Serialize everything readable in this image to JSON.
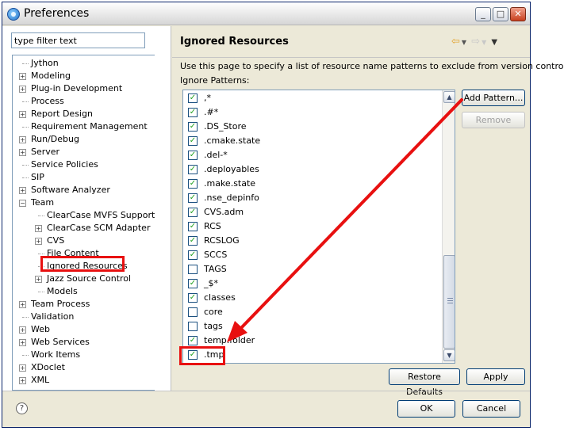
{
  "window": {
    "title": "Preferences"
  },
  "title_buttons": {
    "minimize": "_",
    "maximize": "□",
    "close": "✕"
  },
  "filter": {
    "placeholder": "type filter text"
  },
  "tree": {
    "items": [
      {
        "label": "Jython",
        "depth": 0,
        "expandable": false
      },
      {
        "label": "Modeling",
        "depth": 0,
        "expandable": true
      },
      {
        "label": "Plug-in Development",
        "depth": 0,
        "expandable": true
      },
      {
        "label": "Process",
        "depth": 0,
        "expandable": false
      },
      {
        "label": "Report Design",
        "depth": 0,
        "expandable": true
      },
      {
        "label": "Requirement Management",
        "depth": 0,
        "expandable": false
      },
      {
        "label": "Run/Debug",
        "depth": 0,
        "expandable": true
      },
      {
        "label": "Server",
        "depth": 0,
        "expandable": true
      },
      {
        "label": "Service Policies",
        "depth": 0,
        "expandable": false
      },
      {
        "label": "SIP",
        "depth": 0,
        "expandable": false
      },
      {
        "label": "Software Analyzer",
        "depth": 0,
        "expandable": true
      },
      {
        "label": "Team",
        "depth": 0,
        "expandable": true,
        "expanded": true
      },
      {
        "label": "ClearCase MVFS Support",
        "depth": 1,
        "expandable": false
      },
      {
        "label": "ClearCase SCM Adapter",
        "depth": 1,
        "expandable": true
      },
      {
        "label": "CVS",
        "depth": 1,
        "expandable": true
      },
      {
        "label": "File Content",
        "depth": 1,
        "expandable": false
      },
      {
        "label": "Ignored Resources",
        "depth": 1,
        "expandable": false,
        "selected": true
      },
      {
        "label": "Jazz Source Control",
        "depth": 1,
        "expandable": true
      },
      {
        "label": "Models",
        "depth": 1,
        "expandable": false
      },
      {
        "label": "Team Process",
        "depth": 0,
        "expandable": true
      },
      {
        "label": "Validation",
        "depth": 0,
        "expandable": false
      },
      {
        "label": "Web",
        "depth": 0,
        "expandable": true
      },
      {
        "label": "Web Services",
        "depth": 0,
        "expandable": true
      },
      {
        "label": "Work Items",
        "depth": 0,
        "expandable": false
      },
      {
        "label": "XDoclet",
        "depth": 0,
        "expandable": true
      },
      {
        "label": "XML",
        "depth": 0,
        "expandable": true
      }
    ]
  },
  "page": {
    "title": "Ignored Resources",
    "description": "Use this page to specify a list of resource name patterns to exclude from version control.",
    "patterns_label": "Ignore Patterns:",
    "patterns": [
      {
        "text": ",*",
        "checked": true
      },
      {
        "text": ".#*",
        "checked": true
      },
      {
        "text": ".DS_Store",
        "checked": true
      },
      {
        "text": ".cmake.state",
        "checked": true
      },
      {
        "text": ".del-*",
        "checked": true
      },
      {
        "text": ".deployables",
        "checked": true
      },
      {
        "text": ".make.state",
        "checked": true
      },
      {
        "text": ".nse_depinfo",
        "checked": true
      },
      {
        "text": "CVS.adm",
        "checked": true
      },
      {
        "text": "RCS",
        "checked": true
      },
      {
        "text": "RCSLOG",
        "checked": true
      },
      {
        "text": "SCCS",
        "checked": true
      },
      {
        "text": "TAGS",
        "checked": false
      },
      {
        "text": "_$*",
        "checked": true
      },
      {
        "text": "classes",
        "checked": true
      },
      {
        "text": "core",
        "checked": false
      },
      {
        "text": "tags",
        "checked": false
      },
      {
        "text": "temp.folder",
        "checked": true
      },
      {
        "text": ".tmp",
        "checked": true
      }
    ],
    "add_pattern": "Add Pattern...",
    "remove": "Remove",
    "restore_defaults": "Restore Defaults",
    "apply": "Apply"
  },
  "footer": {
    "help": "?",
    "ok": "OK",
    "cancel": "Cancel"
  },
  "colors": {
    "annotation": "#e81010",
    "check": "#21a121"
  }
}
